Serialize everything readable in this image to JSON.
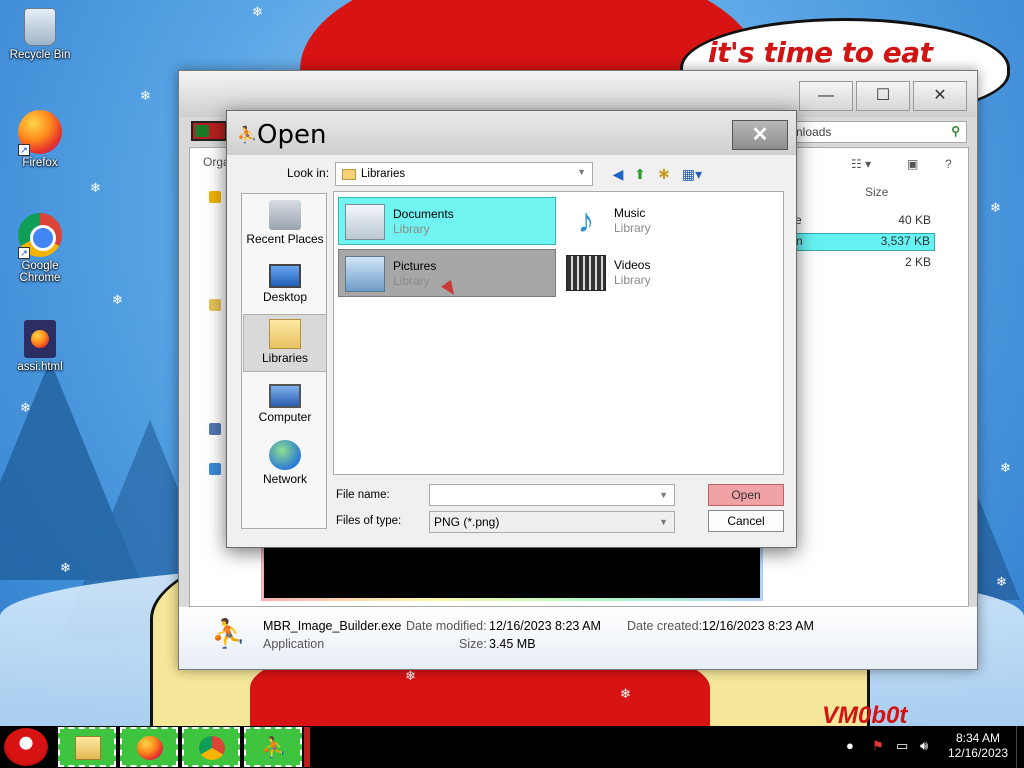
{
  "desktop": {
    "icons": [
      {
        "label": "Recycle Bin",
        "icon": "recycle-bin-icon"
      },
      {
        "label": "Firefox",
        "icon": "firefox-icon"
      },
      {
        "label": "Google Chrome",
        "icon": "chrome-icon"
      },
      {
        "label": "assi.html",
        "icon": "firefox-html-file-icon"
      }
    ],
    "wallpaper_text": "it's time to eat shit",
    "wallpaper_signature": "VM0b0t"
  },
  "explorer": {
    "search_placeholder": "nloads",
    "organize_label": "Orga",
    "column_size": "Size",
    "rows": [
      {
        "name": "e",
        "size": "40 KB",
        "selected": false
      },
      {
        "name": "n",
        "size": "3,537 KB",
        "selected": true
      },
      {
        "name": "",
        "size": "2 KB",
        "selected": false
      }
    ],
    "details": {
      "file_name": "MBR_Image_Builder.exe",
      "file_type": "Application",
      "modified_label": "Date modified:",
      "modified_value": "12/16/2023 8:23 AM",
      "created_label": "Date created:",
      "created_value": "12/16/2023 8:23 AM",
      "size_label": "Size:",
      "size_value": "3.45 MB"
    },
    "window_buttons": {
      "minimize": "—",
      "maximize": "☐",
      "close": "✕"
    }
  },
  "dialog": {
    "title": "Open",
    "close_glyph": "✕",
    "look_in_label": "Look in:",
    "look_in_value": "Libraries",
    "places": [
      {
        "label": "Recent Places",
        "icon": "recent-places-icon",
        "selected": false
      },
      {
        "label": "Desktop",
        "icon": "desktop-icon",
        "selected": false
      },
      {
        "label": "Libraries",
        "icon": "libraries-icon",
        "selected": true
      },
      {
        "label": "Computer",
        "icon": "computer-icon",
        "selected": false
      },
      {
        "label": "Network",
        "icon": "network-icon",
        "selected": false
      }
    ],
    "libraries": [
      {
        "name": "Documents",
        "type": "Library",
        "icon": "documents-library-icon"
      },
      {
        "name": "Music",
        "type": "Library",
        "icon": "music-library-icon"
      },
      {
        "name": "Pictures",
        "type": "Library",
        "icon": "pictures-library-icon"
      },
      {
        "name": "Videos",
        "type": "Library",
        "icon": "videos-library-icon"
      }
    ],
    "file_name_label": "File name:",
    "file_name_value": "",
    "file_type_label": "Files of type:",
    "file_type_value": "PNG (*.png)",
    "open_button": "Open",
    "cancel_button": "Cancel"
  },
  "taskbar": {
    "pinned": [
      {
        "icon": "file-explorer-icon"
      },
      {
        "icon": "firefox-icon"
      },
      {
        "icon": "chrome-icon"
      },
      {
        "icon": "mbr-image-builder-icon"
      }
    ],
    "clock_time": "8:34 AM",
    "clock_date": "12/16/2023"
  }
}
